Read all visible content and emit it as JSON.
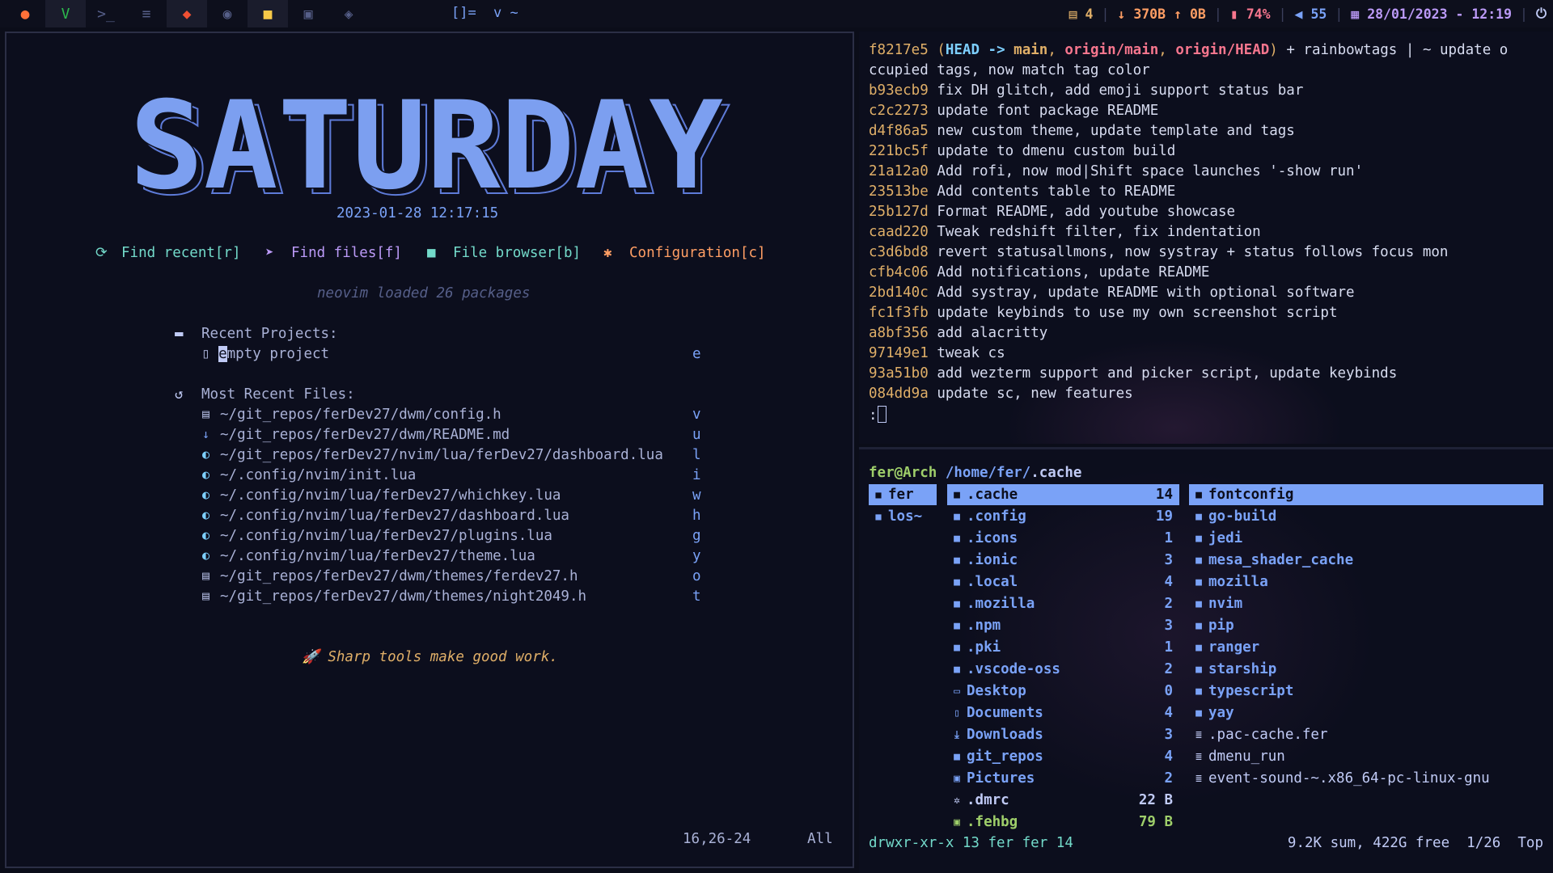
{
  "topbar": {
    "tags": [
      {
        "name": "firefox-icon",
        "glyph": "●",
        "color": "#ff7139"
      },
      {
        "name": "vim-icon",
        "glyph": "V",
        "color": "#2db84d"
      },
      {
        "name": "terminal-icon",
        "glyph": ">_",
        "color": "#565f89"
      },
      {
        "name": "database-icon",
        "glyph": "≡",
        "color": "#565f89"
      },
      {
        "name": "git-icon",
        "glyph": "◆",
        "color": "#f05033"
      },
      {
        "name": "fish-icon",
        "glyph": "◉",
        "color": "#565f89"
      },
      {
        "name": "folder-icon",
        "glyph": "■",
        "color": "#f7c948"
      },
      {
        "name": "image-icon",
        "glyph": "▣",
        "color": "#565f89"
      },
      {
        "name": "layers-icon",
        "glyph": "◈",
        "color": "#565f89"
      }
    ],
    "layout_symbol": "[]=",
    "window_title": "v ~",
    "status": {
      "updates": "4",
      "net_down": "370B",
      "net_up": "0B",
      "battery": "74%",
      "volume": "55",
      "datetime": "28/01/2023 - 12:19"
    }
  },
  "dashboard": {
    "title_art": "SATURDAY",
    "datetime": "2023-01-28 12:17:15",
    "shortcuts": [
      {
        "icon": "refresh-icon",
        "glyph": "⟳",
        "label": "Find recent[r]",
        "color": "#73daca"
      },
      {
        "icon": "send-icon",
        "glyph": "➤",
        "label": "Find files[f]",
        "color": "#bb9af7"
      },
      {
        "icon": "folder-icon",
        "glyph": "■",
        "label": "File browser[b]",
        "color": "#73daca"
      },
      {
        "icon": "gear-icon",
        "glyph": "✱",
        "label": "Configuration[c]",
        "color": "#ff9e64"
      }
    ],
    "loaded": "neovim loaded 26 packages",
    "projects_header": "Recent Projects:",
    "project": {
      "first": "e",
      "rest": "mpty project",
      "key": "e"
    },
    "files_header": "Most Recent Files:",
    "files": [
      {
        "icon": "file-icon",
        "glyph": "▤",
        "path": "~/git_repos/ferDev27/dwm/config.h",
        "key": "v"
      },
      {
        "icon": "markdown-icon",
        "glyph": "↓",
        "path": "~/git_repos/ferDev27/dwm/README.md",
        "key": "u"
      },
      {
        "icon": "lua-icon",
        "glyph": "◐",
        "path": "~/git_repos/ferDev27/nvim/lua/ferDev27/dashboard.lua",
        "key": "l"
      },
      {
        "icon": "lua-icon",
        "glyph": "◐",
        "path": "~/.config/nvim/init.lua",
        "key": "i"
      },
      {
        "icon": "lua-icon",
        "glyph": "◐",
        "path": "~/.config/nvim/lua/ferDev27/whichkey.lua",
        "key": "w"
      },
      {
        "icon": "lua-icon",
        "glyph": "◐",
        "path": "~/.config/nvim/lua/ferDev27/dashboard.lua",
        "key": "h"
      },
      {
        "icon": "lua-icon",
        "glyph": "◐",
        "path": "~/.config/nvim/lua/ferDev27/plugins.lua",
        "key": "g"
      },
      {
        "icon": "lua-icon",
        "glyph": "◐",
        "path": "~/.config/nvim/lua/ferDev27/theme.lua",
        "key": "y"
      },
      {
        "icon": "file-icon",
        "glyph": "▤",
        "path": "~/git_repos/ferDev27/dwm/themes/ferdev27.h",
        "key": "o"
      },
      {
        "icon": "file-icon",
        "glyph": "▤",
        "path": "~/git_repos/ferDev27/dwm/themes/night2049.h",
        "key": "t"
      }
    ],
    "footer": "Sharp tools make good work.",
    "ruler": "16,26-24",
    "scroll": "All"
  },
  "gitlog": {
    "first_line": {
      "hash": "f8217e5",
      "head": "HEAD -> ",
      "main": "main",
      "om": "origin/main",
      "oh": "origin/HEAD",
      "rest": " + rainbowtags | ~ update o",
      "wrap": "ccupied tags, now match tag color"
    },
    "entries": [
      {
        "hash": "b93ecb9",
        "msg": "fix DH glitch, add emoji support status bar"
      },
      {
        "hash": "c2c2273",
        "msg": "update font package README"
      },
      {
        "hash": "d4f86a5",
        "msg": "new custom theme, update template and tags"
      },
      {
        "hash": "221bc5f",
        "msg": "update to dmenu custom build"
      },
      {
        "hash": "21a12a0",
        "msg": "Add rofi, now mod|Shift space launches '-show run'"
      },
      {
        "hash": "23513be",
        "msg": "Add contents table to README"
      },
      {
        "hash": "25b127d",
        "msg": "Format README, add youtube showcase"
      },
      {
        "hash": "caad220",
        "msg": "Tweak redshift filter, fix indentation"
      },
      {
        "hash": "c3d6bd8",
        "msg": "revert statusallmons, now systray + status follows focus mon"
      },
      {
        "hash": "cfb4c06",
        "msg": "Add notifications, update README"
      },
      {
        "hash": "2bd140c",
        "msg": "Add systray, update README with optional software"
      },
      {
        "hash": "fc1f3fb",
        "msg": "update keybinds to use my own screenshot script"
      },
      {
        "hash": "a8bf356",
        "msg": "add alacritty"
      },
      {
        "hash": "97149e1",
        "msg": "tweak cs"
      },
      {
        "hash": "93a51b0",
        "msg": "add wezterm support and picker script, update keybinds"
      },
      {
        "hash": "084dd9a",
        "msg": "update sc, new features"
      }
    ],
    "prompt": ":"
  },
  "ranger": {
    "user_host": "fer@Arch",
    "path_prefix": "/home/fer/",
    "path_current": ".cache",
    "col1": [
      {
        "name": "fer",
        "selected": true
      },
      {
        "name": "los~",
        "selected": false
      }
    ],
    "col2": [
      {
        "icon": "folder-icon",
        "glyph": "■",
        "name": ".cache",
        "count": "14",
        "kind": "dir",
        "selected": true
      },
      {
        "icon": "folder-icon",
        "glyph": "■",
        "name": ".config",
        "count": "19",
        "kind": "dir"
      },
      {
        "icon": "folder-icon",
        "glyph": "■",
        "name": ".icons",
        "count": "1",
        "kind": "dir"
      },
      {
        "icon": "folder-icon",
        "glyph": "■",
        "name": ".ionic",
        "count": "3",
        "kind": "dir"
      },
      {
        "icon": "folder-icon",
        "glyph": "■",
        "name": ".local",
        "count": "4",
        "kind": "dir"
      },
      {
        "icon": "folder-icon",
        "glyph": "■",
        "name": ".mozilla",
        "count": "2",
        "kind": "dir"
      },
      {
        "icon": "folder-icon",
        "glyph": "■",
        "name": ".npm",
        "count": "3",
        "kind": "dir"
      },
      {
        "icon": "folder-icon",
        "glyph": "■",
        "name": ".pki",
        "count": "1",
        "kind": "dir"
      },
      {
        "icon": "folder-icon",
        "glyph": "■",
        "name": ".vscode-oss",
        "count": "2",
        "kind": "dir"
      },
      {
        "icon": "desktop-icon",
        "glyph": "▭",
        "name": "Desktop",
        "count": "0",
        "kind": "dir"
      },
      {
        "icon": "document-icon",
        "glyph": "▯",
        "name": "Documents",
        "count": "4",
        "kind": "dir"
      },
      {
        "icon": "download-icon",
        "glyph": "⤓",
        "name": "Downloads",
        "count": "3",
        "kind": "dir"
      },
      {
        "icon": "folder-icon",
        "glyph": "■",
        "name": "git_repos",
        "count": "4",
        "kind": "dir"
      },
      {
        "icon": "picture-icon",
        "glyph": "▣",
        "name": "Pictures",
        "count": "2",
        "kind": "dir"
      },
      {
        "icon": "gear-icon",
        "glyph": "✲",
        "name": ".dmrc",
        "count": "22 B",
        "kind": "file"
      },
      {
        "icon": "image-icon",
        "glyph": "▣",
        "name": ".fehbg",
        "count": "79 B",
        "kind": "exe"
      }
    ],
    "col3": [
      {
        "icon": "folder-icon",
        "glyph": "■",
        "name": "fontconfig",
        "kind": "dir",
        "selected": true
      },
      {
        "icon": "folder-icon",
        "glyph": "■",
        "name": "go-build",
        "kind": "dir"
      },
      {
        "icon": "folder-icon",
        "glyph": "■",
        "name": "jedi",
        "kind": "dir"
      },
      {
        "icon": "folder-icon",
        "glyph": "■",
        "name": "mesa_shader_cache",
        "kind": "dir"
      },
      {
        "icon": "folder-icon",
        "glyph": "■",
        "name": "mozilla",
        "kind": "dir"
      },
      {
        "icon": "folder-icon",
        "glyph": "■",
        "name": "nvim",
        "kind": "dir"
      },
      {
        "icon": "folder-icon",
        "glyph": "■",
        "name": "pip",
        "kind": "dir"
      },
      {
        "icon": "folder-icon",
        "glyph": "■",
        "name": "ranger",
        "kind": "dir"
      },
      {
        "icon": "folder-icon",
        "glyph": "■",
        "name": "starship",
        "kind": "dir"
      },
      {
        "icon": "folder-icon",
        "glyph": "■",
        "name": "typescript",
        "kind": "dir"
      },
      {
        "icon": "folder-icon",
        "glyph": "■",
        "name": "yay",
        "kind": "dir"
      },
      {
        "icon": "text-file-icon",
        "glyph": "≣",
        "name": ".pac-cache.fer",
        "kind": "file"
      },
      {
        "icon": "text-file-icon",
        "glyph": "≣",
        "name": "dmenu_run",
        "kind": "file"
      },
      {
        "icon": "text-file-icon",
        "glyph": "≣",
        "name": "event-sound-~.x86_64-pc-linux-gnu",
        "kind": "file"
      }
    ],
    "status_left": "drwxr-xr-x 13 fer fer 14",
    "status_right": "9.2K sum, 422G free  1/26  Top"
  }
}
